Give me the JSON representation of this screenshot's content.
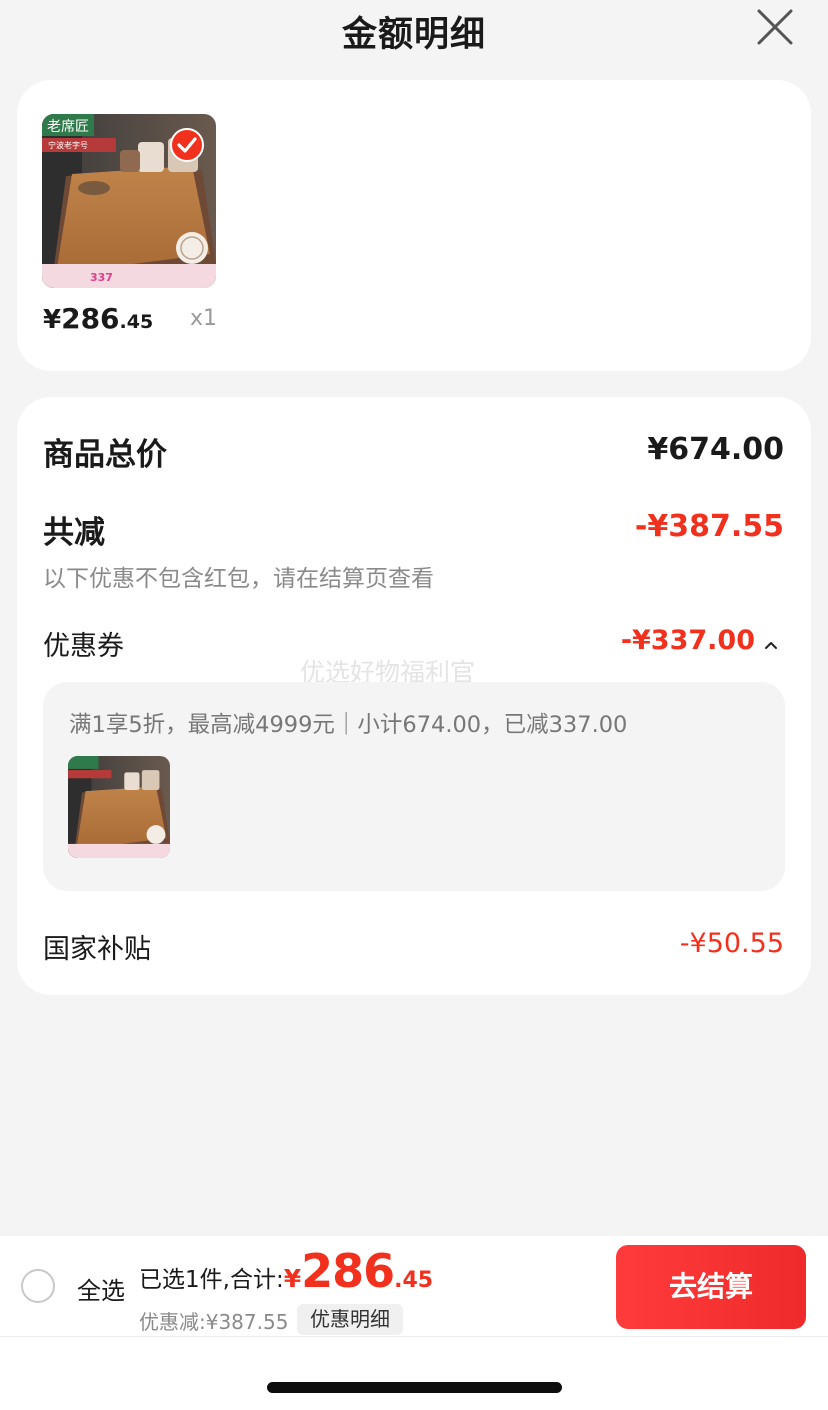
{
  "header": {
    "title": "金额明细",
    "close_icon": "close-icon"
  },
  "product": {
    "brand_badge": "老席匠",
    "price_yen": "¥",
    "price_int": "286",
    "price_dec": ".45",
    "quantity": "x1",
    "selected": true
  },
  "summary": {
    "total_label": "商品总价",
    "total_value": "¥674.00",
    "reduce_label": "共减",
    "reduce_value": "-¥387.55",
    "reduce_note": "以下优惠不包含红包，请在结算页查看",
    "coupon_label": "优惠券",
    "coupon_value": "-¥337.00",
    "coupon_detail": "满1享5折，最高减4999元｜小计674.00，已减337.00",
    "watermark": "优选好物福利官",
    "subsidy_label": "国家补贴",
    "subsidy_value": "-¥50.55"
  },
  "bottom_bar": {
    "select_all": "全选",
    "selected_prefix": "已选1件,合计:",
    "total_yen": "¥",
    "total_int": "286",
    "total_dec": ".45",
    "discount_text": "优惠减:¥387.55",
    "detail_link": "优惠明细",
    "checkout": "去结算"
  },
  "colors": {
    "accent_red": "#f2301e",
    "button_red": "#ef2a2a"
  }
}
